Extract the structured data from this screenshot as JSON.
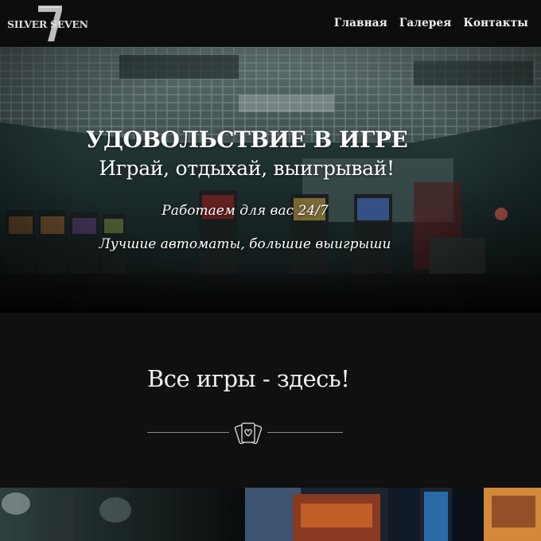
{
  "header": {
    "logo_text": "SILVER SEVEN",
    "nav": [
      {
        "label": "Главная"
      },
      {
        "label": "Галерея"
      },
      {
        "label": "Контакты"
      }
    ]
  },
  "hero": {
    "title": "УДОВОЛЬСТВИЕ В ИГРЕ",
    "subtitle": "Играй, отдыхай, выигрывай!",
    "line1": "Работаем для вас 24/7",
    "line2": "Лучшие автоматы, большие выигрыши"
  },
  "games": {
    "title": "Все игры - здесь!",
    "icon": "playing-cards-icon"
  },
  "colors": {
    "background": "#101010",
    "header": "#0d0d0d",
    "text": "#ffffff",
    "divider": "#8a8a8a"
  }
}
